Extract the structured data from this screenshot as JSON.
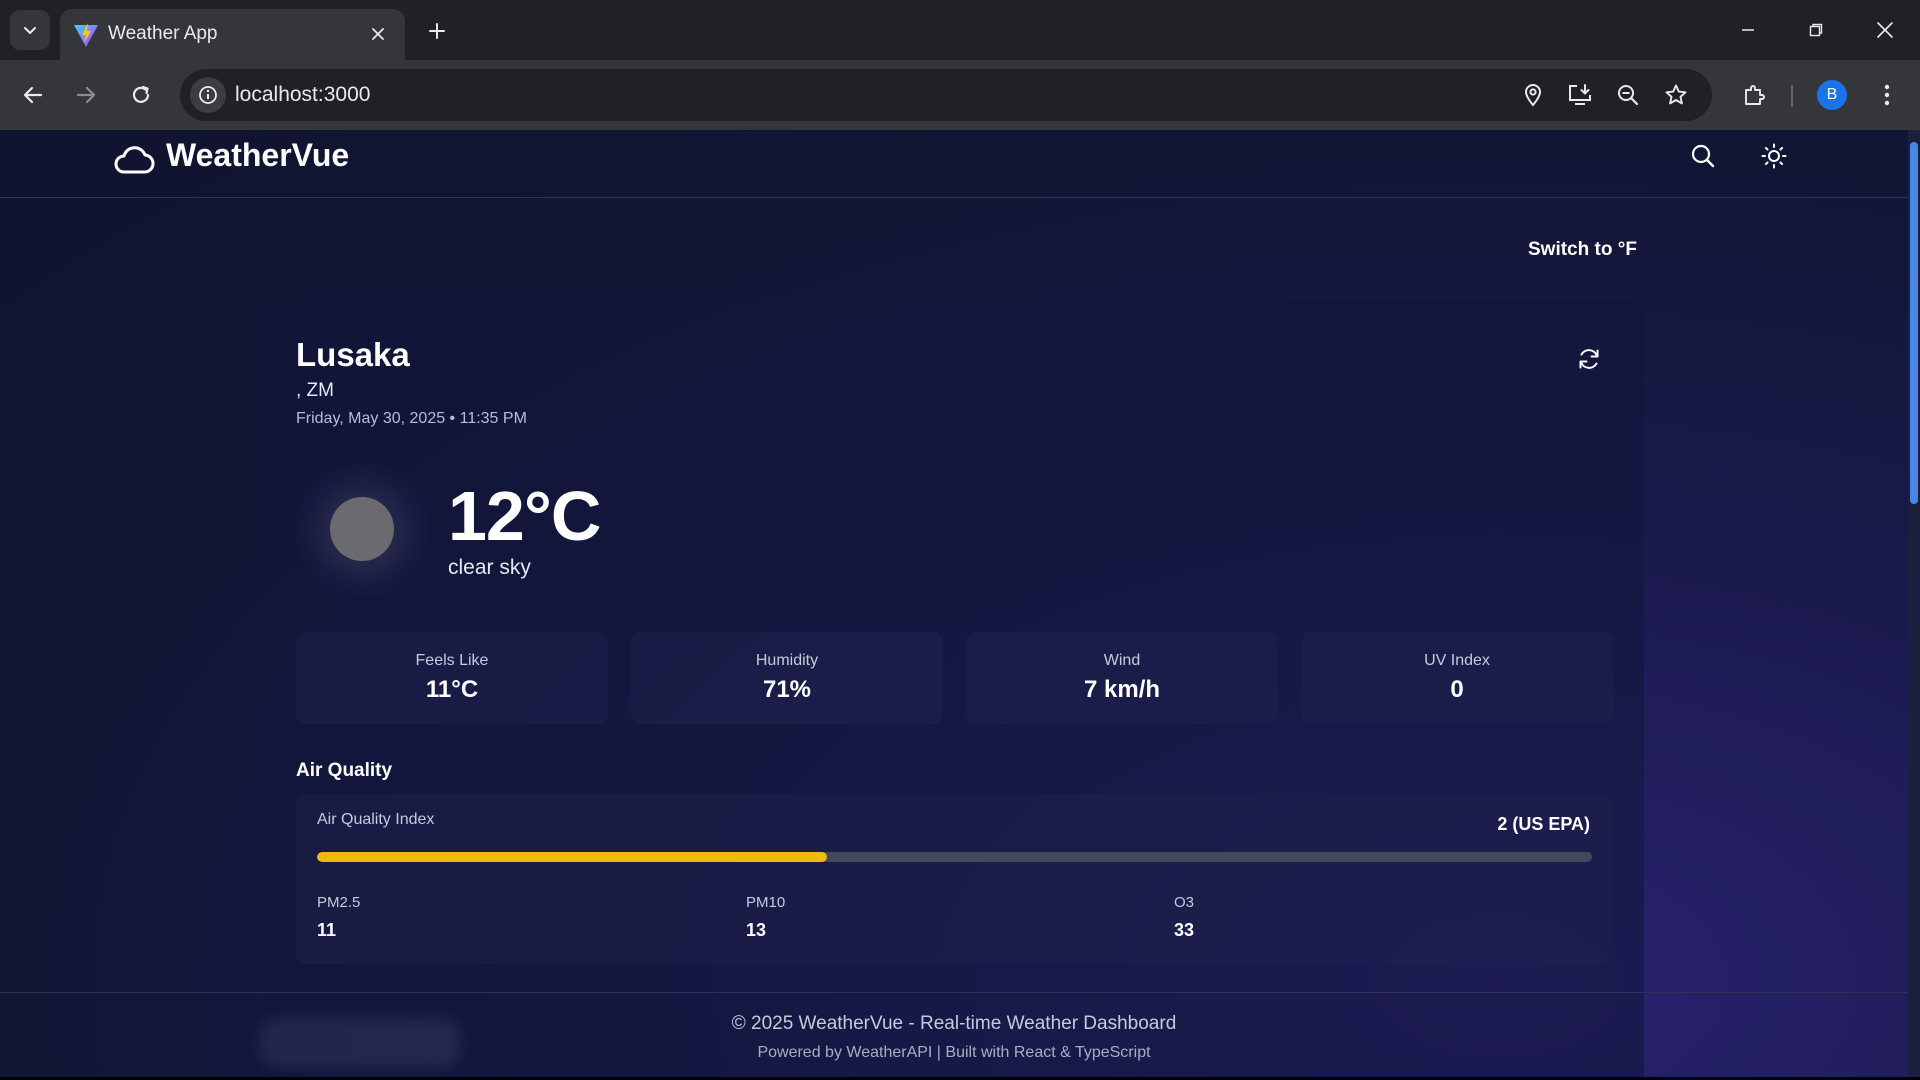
{
  "browser": {
    "tab_title": "Weather App",
    "url": "localhost:3000",
    "profile_initial": "B",
    "icons": {
      "tab_search": "chevron-down-icon",
      "favicon": "vite-logo-icon",
      "tab_close": "close-icon",
      "new_tab": "plus-icon",
      "back": "arrow-left-icon",
      "forward": "arrow-right-icon",
      "reload": "reload-icon",
      "site_info": "info-icon",
      "location": "location-pin-icon",
      "install": "install-app-icon",
      "zoom": "zoom-out-icon",
      "bookmark": "star-icon",
      "extensions": "puzzle-icon",
      "menu": "more-vertical-icon"
    }
  },
  "app": {
    "logo_text": "WeatherVue",
    "logo_icon": "cloud-icon",
    "header_icons": [
      "search-icon",
      "sun-icon"
    ],
    "unit_toggle_label": "Switch to °F"
  },
  "location": {
    "city": "Lusaka",
    "country": ", ZM",
    "datetime": "Friday, May 30, 2025 • 11:35 PM",
    "refresh_icon": "refresh-icon"
  },
  "current": {
    "temperature": "12°C",
    "condition": "clear sky",
    "condition_icon": "clear-night-icon"
  },
  "stats": [
    {
      "label": "Feels Like",
      "value": "11°C"
    },
    {
      "label": "Humidity",
      "value": "71%"
    },
    {
      "label": "Wind",
      "value": "7 km/h"
    },
    {
      "label": "UV Index",
      "value": "0"
    }
  ],
  "air_quality": {
    "title": "Air Quality",
    "index_label": "Air Quality Index",
    "index_value": "2 (US EPA)",
    "bar_fill_fraction": 0.4,
    "bar_color": "#f2b90c",
    "pollutants": [
      {
        "label": "PM2.5",
        "value": "11"
      },
      {
        "label": "PM10",
        "value": "13"
      },
      {
        "label": "O3",
        "value": "33"
      }
    ]
  },
  "footer": {
    "copyright": "© 2025 WeatherVue - Real-time Weather Dashboard",
    "powered_by": "Powered by WeatherAPI | Built with React & TypeScript"
  },
  "colors": {
    "page_bg": "#111634",
    "accent_blue": "#1a73e8",
    "aqi_yellow": "#f2b90c"
  }
}
